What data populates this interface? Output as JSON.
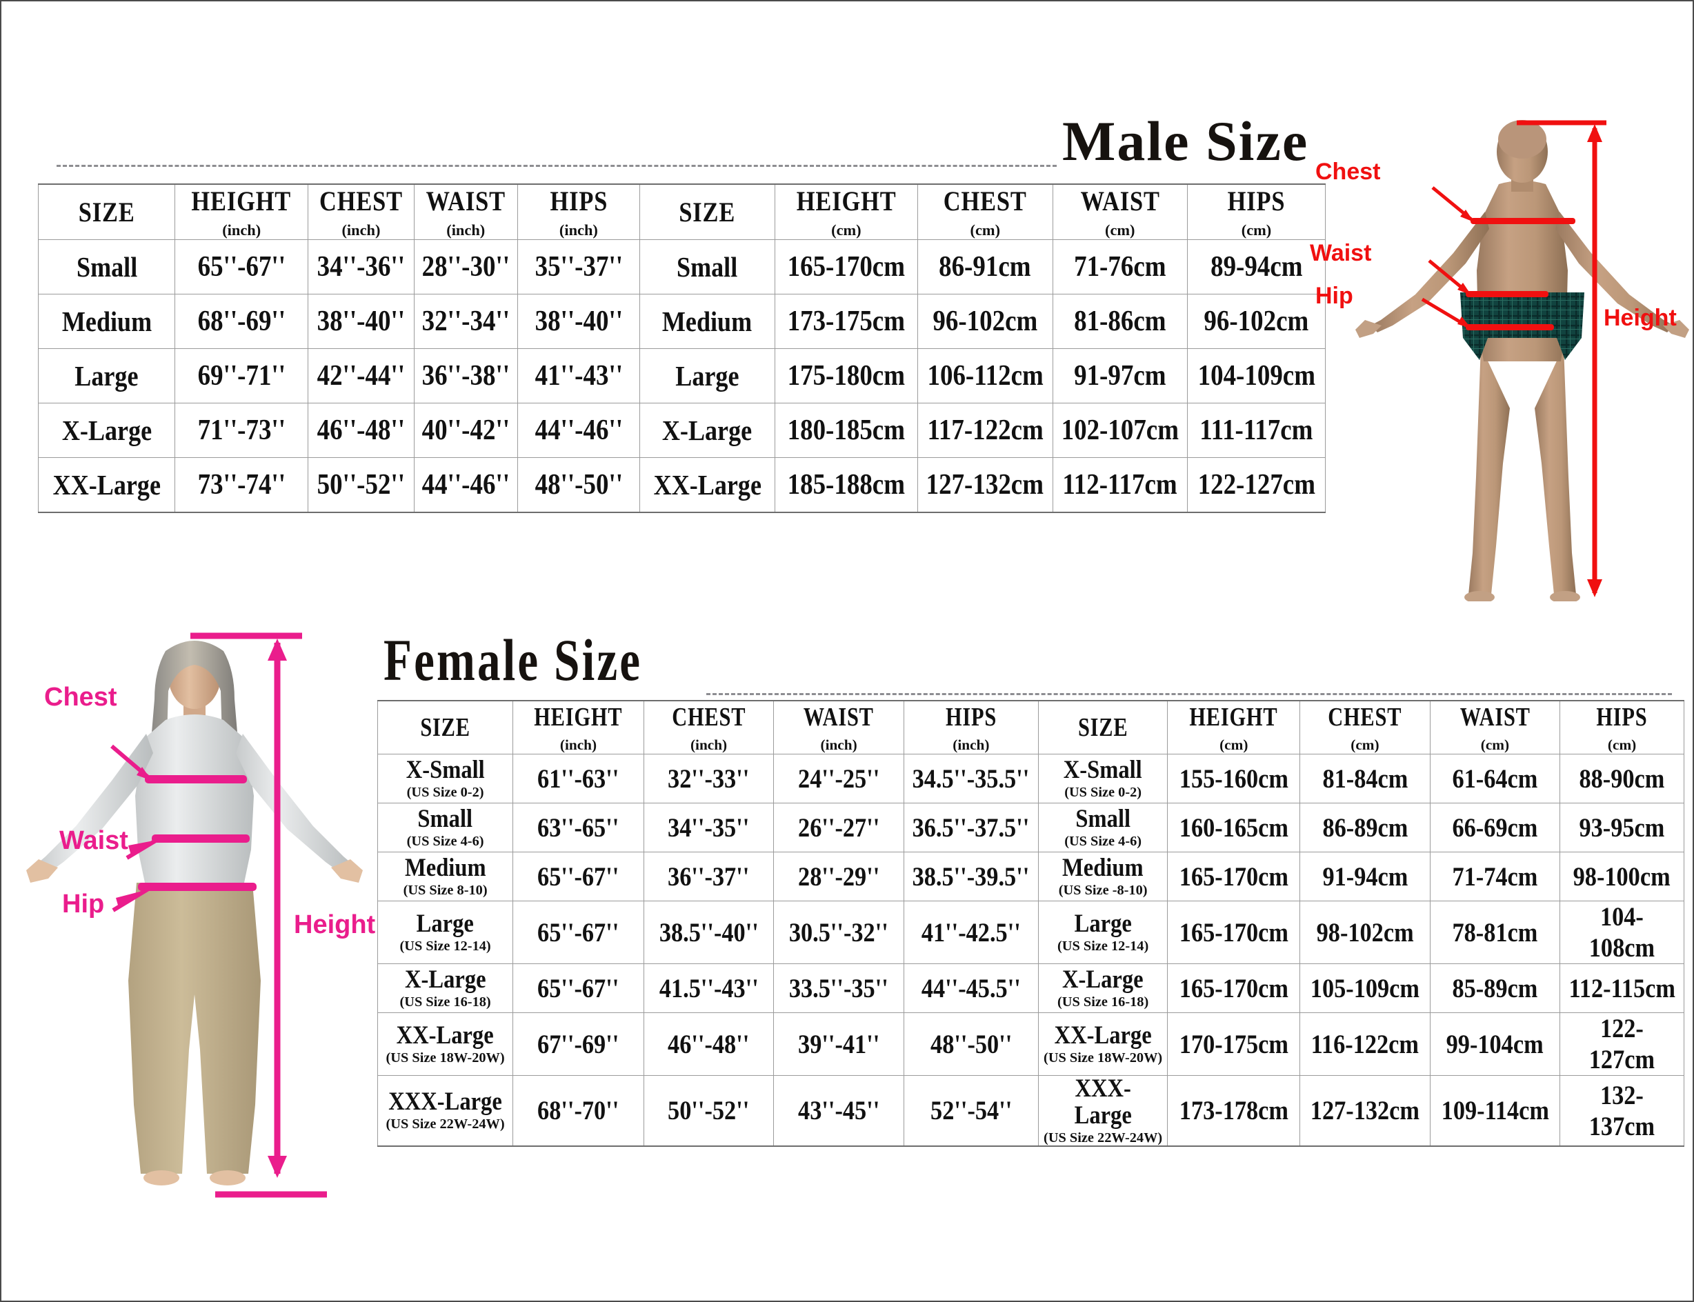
{
  "male": {
    "title": "Male Size",
    "columns_inch": [
      {
        "name": "SIZE",
        "unit": ""
      },
      {
        "name": "HEIGHT",
        "unit": "(inch)"
      },
      {
        "name": "CHEST",
        "unit": "(inch)"
      },
      {
        "name": "WAIST",
        "unit": "(inch)"
      },
      {
        "name": "HIPS",
        "unit": "(inch)"
      }
    ],
    "columns_cm": [
      {
        "name": "SIZE",
        "unit": ""
      },
      {
        "name": "HEIGHT",
        "unit": "(cm)"
      },
      {
        "name": "CHEST",
        "unit": "(cm)"
      },
      {
        "name": "WAIST",
        "unit": "(cm)"
      },
      {
        "name": "HIPS",
        "unit": "(cm)"
      }
    ],
    "rows": [
      {
        "size": "Small",
        "height_in": "65''-67''",
        "chest_in": "34''-36''",
        "waist_in": "28''-30''",
        "hips_in": "35''-37''",
        "size_cm": "Small",
        "height_cm": "165-170cm",
        "chest_cm": "86-91cm",
        "waist_cm": "71-76cm",
        "hips_cm": "89-94cm"
      },
      {
        "size": "Medium",
        "height_in": "68''-69''",
        "chest_in": "38''-40''",
        "waist_in": "32''-34''",
        "hips_in": "38''-40''",
        "size_cm": "Medium",
        "height_cm": "173-175cm",
        "chest_cm": "96-102cm",
        "waist_cm": "81-86cm",
        "hips_cm": "96-102cm"
      },
      {
        "size": "Large",
        "height_in": "69''-71''",
        "chest_in": "42''-44''",
        "waist_in": "36''-38''",
        "hips_in": "41''-43''",
        "size_cm": "Large",
        "height_cm": "175-180cm",
        "chest_cm": "106-112cm",
        "waist_cm": "91-97cm",
        "hips_cm": "104-109cm"
      },
      {
        "size": "X-Large",
        "height_in": "71''-73''",
        "chest_in": "46''-48''",
        "waist_in": "40''-42''",
        "hips_in": "44''-46''",
        "size_cm": "X-Large",
        "height_cm": "180-185cm",
        "chest_cm": "117-122cm",
        "waist_cm": "102-107cm",
        "hips_cm": "111-117cm"
      },
      {
        "size": "XX-Large",
        "height_in": "73''-74''",
        "chest_in": "50''-52''",
        "waist_in": "44''-46''",
        "hips_in": "48''-50''",
        "size_cm": "XX-Large",
        "height_cm": "185-188cm",
        "chest_cm": "127-132cm",
        "waist_cm": "112-117cm",
        "hips_cm": "122-127cm"
      }
    ],
    "figure": {
      "labels": {
        "chest": "Chest",
        "waist": "Waist",
        "hip": "Hip",
        "height": "Height"
      },
      "accent_color": "#f01010"
    }
  },
  "female": {
    "title": "Female Size",
    "columns_inch": [
      {
        "name": "SIZE",
        "unit": ""
      },
      {
        "name": "HEIGHT",
        "unit": "(inch)"
      },
      {
        "name": "CHEST",
        "unit": "(inch)"
      },
      {
        "name": "WAIST",
        "unit": "(inch)"
      },
      {
        "name": "HIPS",
        "unit": "(inch)"
      }
    ],
    "columns_cm": [
      {
        "name": "SIZE",
        "unit": ""
      },
      {
        "name": "HEIGHT",
        "unit": "(cm)"
      },
      {
        "name": "CHEST",
        "unit": "(cm)"
      },
      {
        "name": "WAIST",
        "unit": "(cm)"
      },
      {
        "name": "HIPS",
        "unit": "(cm)"
      }
    ],
    "rows": [
      {
        "size": "X-Small",
        "us_size": "(US Size 0-2)",
        "height_in": "61''-63''",
        "chest_in": "32''-33''",
        "waist_in": "24''-25''",
        "hips_in": "34.5''-35.5''",
        "size_cm": "X-Small",
        "us_size_cm": "(US Size 0-2)",
        "height_cm": "155-160cm",
        "chest_cm": "81-84cm",
        "waist_cm": "61-64cm",
        "hips_cm": "88-90cm"
      },
      {
        "size": "Small",
        "us_size": "(US Size 4-6)",
        "height_in": "63''-65''",
        "chest_in": "34''-35''",
        "waist_in": "26''-27''",
        "hips_in": "36.5''-37.5''",
        "size_cm": "Small",
        "us_size_cm": "(US Size 4-6)",
        "height_cm": "160-165cm",
        "chest_cm": "86-89cm",
        "waist_cm": "66-69cm",
        "hips_cm": "93-95cm"
      },
      {
        "size": "Medium",
        "us_size": "(US Size 8-10)",
        "height_in": "65''-67''",
        "chest_in": "36''-37''",
        "waist_in": "28''-29''",
        "hips_in": "38.5''-39.5''",
        "size_cm": "Medium",
        "us_size_cm": "(US Size -8-10)",
        "height_cm": "165-170cm",
        "chest_cm": "91-94cm",
        "waist_cm": "71-74cm",
        "hips_cm": "98-100cm"
      },
      {
        "size": "Large",
        "us_size": "(US Size 12-14)",
        "height_in": "65''-67''",
        "chest_in": "38.5''-40''",
        "waist_in": "30.5''-32''",
        "hips_in": "41''-42.5''",
        "size_cm": "Large",
        "us_size_cm": "(US Size 12-14)",
        "height_cm": "165-170cm",
        "chest_cm": "98-102cm",
        "waist_cm": "78-81cm",
        "hips_cm": "104-108cm"
      },
      {
        "size": "X-Large",
        "us_size": "(US Size 16-18)",
        "height_in": "65''-67''",
        "chest_in": "41.5''-43''",
        "waist_in": "33.5''-35''",
        "hips_in": "44''-45.5''",
        "size_cm": "X-Large",
        "us_size_cm": "(US Size 16-18)",
        "height_cm": "165-170cm",
        "chest_cm": "105-109cm",
        "waist_cm": "85-89cm",
        "hips_cm": "112-115cm"
      },
      {
        "size": "XX-Large",
        "us_size": "(US Size 18W-20W)",
        "height_in": "67''-69''",
        "chest_in": "46''-48''",
        "waist_in": "39''-41''",
        "hips_in": "48''-50''",
        "size_cm": "XX-Large",
        "us_size_cm": "(US Size 18W-20W)",
        "height_cm": "170-175cm",
        "chest_cm": "116-122cm",
        "waist_cm": "99-104cm",
        "hips_cm": "122-127cm"
      },
      {
        "size": "XXX-Large",
        "us_size": "(US Size 22W-24W)",
        "height_in": "68''-70''",
        "chest_in": "50''-52''",
        "waist_in": "43''-45''",
        "hips_in": "52''-54''",
        "size_cm": "XXX-Large",
        "us_size_cm": "(US Size 22W-24W)",
        "height_cm": "173-178cm",
        "chest_cm": "127-132cm",
        "waist_cm": "109-114cm",
        "hips_cm": "132-137cm"
      }
    ],
    "figure": {
      "labels": {
        "chest": "Chest",
        "waist": "Waist",
        "hip": "Hip",
        "height": "Height"
      },
      "accent_color": "#ea1d8c"
    }
  }
}
